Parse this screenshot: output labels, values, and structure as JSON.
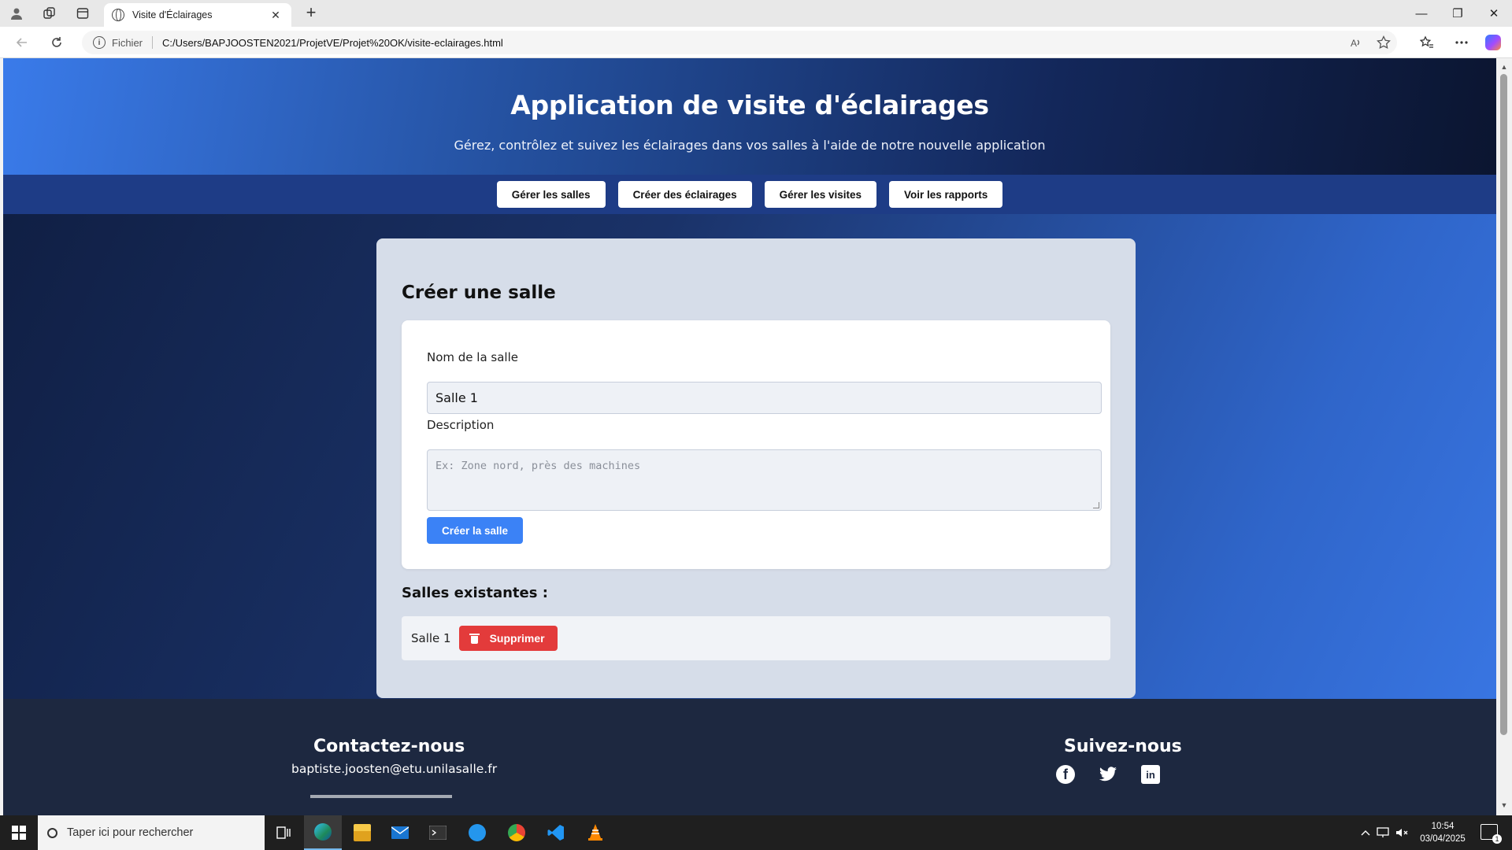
{
  "browser": {
    "tab_title": "Visite d'Éclairages",
    "security_label": "Fichier",
    "url": "C:/Users/BAPJOOSTEN2021/ProjetVE/Projet%20OK/visite-eclairages.html",
    "new_tab_symbol": "+",
    "tab_close_symbol": "✕",
    "controls": {
      "minimize": "—",
      "maximize": "❐",
      "close": "✕"
    }
  },
  "page": {
    "header": {
      "title": "Application de visite d'éclairages",
      "subtitle": "Gérez, contrôlez et suivez les éclairages dans vos salles à l'aide de notre nouvelle application"
    },
    "nav": [
      {
        "label": "Gérer les salles"
      },
      {
        "label": "Créer des éclairages"
      },
      {
        "label": "Gérer les visites"
      },
      {
        "label": "Voir les rapports"
      }
    ],
    "create_room": {
      "title": "Créer une salle",
      "name_label": "Nom de la salle",
      "name_value": "Salle 1",
      "description_label": "Description",
      "description_placeholder": "Ex: Zone nord, près des machines",
      "submit_label": "Créer la salle"
    },
    "existing_rooms": {
      "title": "Salles existantes :",
      "rooms": [
        {
          "name": "Salle 1",
          "delete_label": "Supprimer"
        }
      ]
    },
    "footer": {
      "contact_title": "Contactez-nous",
      "email": "baptiste.joosten@etu.unilasalle.fr",
      "follow_title": "Suivez-nous",
      "social_icons": [
        "facebook-icon",
        "twitter-icon",
        "linkedin-icon"
      ]
    }
  },
  "taskbar": {
    "search_placeholder": "Taper ici pour rechercher",
    "time": "10:54",
    "date": "03/04/2025",
    "notification_count": "1"
  },
  "colors": {
    "accent_blue": "#3b82f6",
    "delete_red": "#e33b3b",
    "nav_bar": "#1e3c86",
    "footer": "#1d2840"
  }
}
